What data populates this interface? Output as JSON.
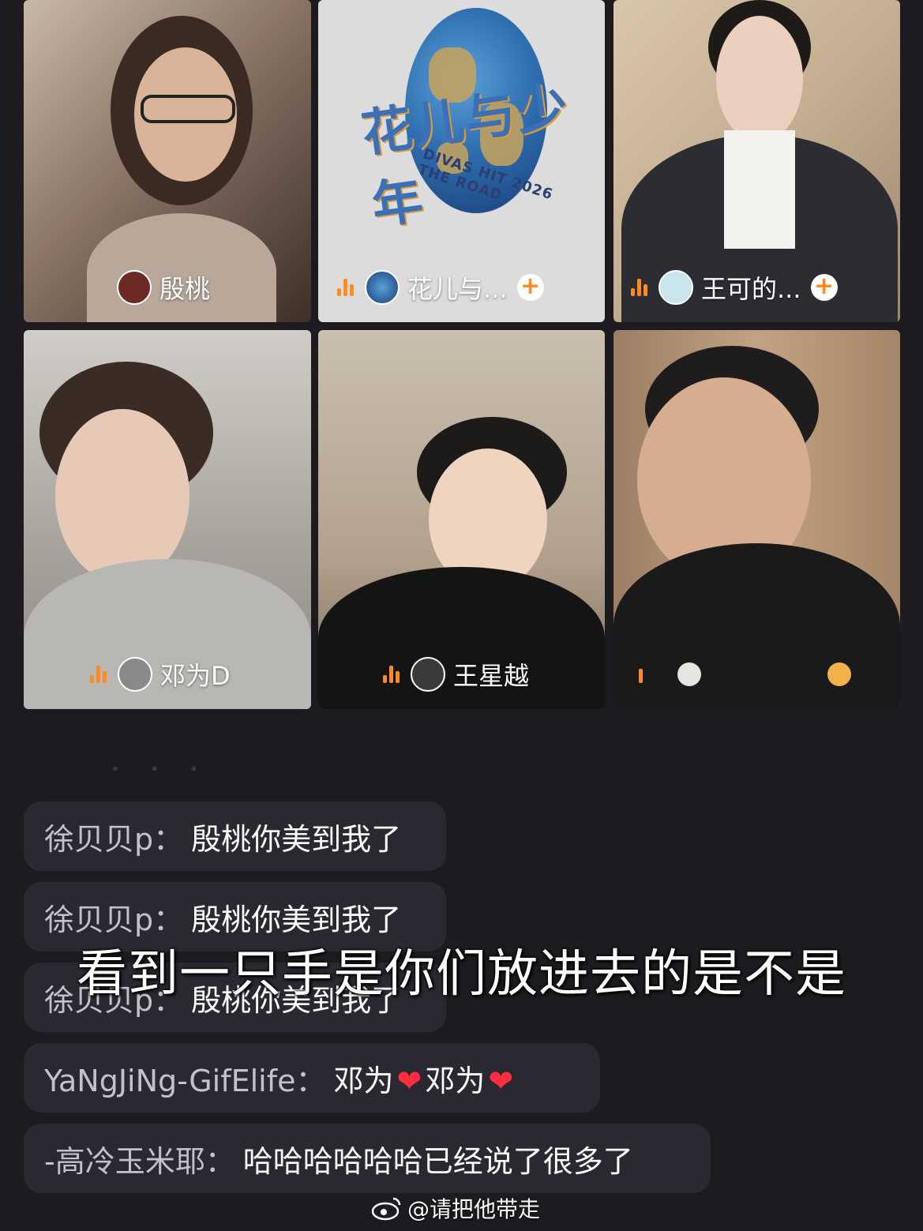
{
  "tiles": [
    {
      "name": "殷桃",
      "has_plus": false
    },
    {
      "name": "花儿与...",
      "has_plus": true
    },
    {
      "name": "王可的...",
      "has_plus": true
    },
    {
      "name": "邓为D",
      "has_plus": false
    },
    {
      "name": "王星越",
      "has_plus": false
    },
    {
      "name": "",
      "has_plus": false
    }
  ],
  "show_logo": {
    "title": "花儿与少年",
    "subtitle": "DIVAS HIT 2026 THE ROAD"
  },
  "comments": [
    {
      "user": "徐贝贝p：",
      "text": "殷桃你美到我了"
    },
    {
      "user": "徐贝贝p：",
      "text": "殷桃你美到我了"
    },
    {
      "user": "徐贝贝p：",
      "text": "殷桃你美到我了"
    },
    {
      "user": "YaNgJiNg-GifElife：",
      "text_a": "邓为",
      "text_b": "邓为"
    },
    {
      "user": "-高冷玉米耶：",
      "text": "哈哈哈哈哈哈已经说了很多了"
    }
  ],
  "subtitle": "看到一只手是你们放进去的是不是",
  "watermark": "@请把他带走",
  "colors": {
    "accent": "#ff8a1e",
    "background": "#1d1b1f",
    "heart": "#ff2e3f"
  }
}
